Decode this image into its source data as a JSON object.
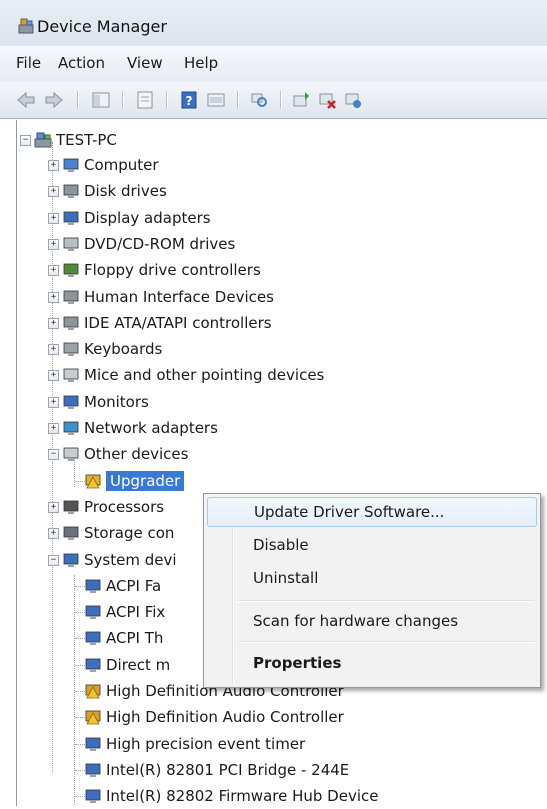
{
  "window": {
    "title": "Device Manager"
  },
  "menu_bar": [
    "File",
    "Action",
    "View",
    "Help"
  ],
  "toolbar": {
    "buttons": [
      "back-arrow-icon",
      "forward-arrow-icon",
      "show-hide-tree-icon",
      "properties-icon",
      "help-icon",
      "update-driver-icon",
      "scan-hardware-icon",
      "update-driver-software-icon",
      "uninstall-icon",
      "disable-icon"
    ]
  },
  "tree": {
    "root": "TEST-PC",
    "items": [
      {
        "label": "Computer",
        "icon": "computer-icon"
      },
      {
        "label": "Disk drives",
        "icon": "disk-drive-icon"
      },
      {
        "label": "Display adapters",
        "icon": "display-adapter-icon"
      },
      {
        "label": "DVD/CD-ROM drives",
        "icon": "dvd-icon"
      },
      {
        "label": "Floppy drive controllers",
        "icon": "floppy-controller-icon"
      },
      {
        "label": "Human Interface Devices",
        "icon": "hid-icon"
      },
      {
        "label": "IDE ATA/ATAPI controllers",
        "icon": "ide-controller-icon"
      },
      {
        "label": "Keyboards",
        "icon": "keyboard-icon"
      },
      {
        "label": "Mice and other pointing devices",
        "icon": "mouse-icon"
      },
      {
        "label": "Monitors",
        "icon": "monitor-icon"
      },
      {
        "label": "Network adapters",
        "icon": "network-adapter-icon"
      },
      {
        "label": "Other devices",
        "icon": "unknown-device-icon"
      },
      {
        "label": "Upgrader",
        "icon": "warning-device-icon"
      },
      {
        "label": "Processors",
        "icon": "processor-icon"
      },
      {
        "label": "Storage con",
        "icon": "storage-controller-icon"
      },
      {
        "label": "System devi",
        "icon": "system-device-icon"
      },
      {
        "label": "ACPI Fa",
        "icon": "system-device-icon"
      },
      {
        "label": "ACPI Fix",
        "icon": "system-device-icon"
      },
      {
        "label": "ACPI Th",
        "icon": "system-device-icon"
      },
      {
        "label": "Direct m",
        "icon": "system-device-icon"
      },
      {
        "label": "High Definition Audio Controller",
        "icon": "audio-controller-icon"
      },
      {
        "label": "High Definition Audio Controller",
        "icon": "audio-controller-icon"
      },
      {
        "label": "High precision event timer",
        "icon": "system-device-icon"
      },
      {
        "label": "Intel(R) 82801 PCI Bridge - 244E",
        "icon": "system-device-icon"
      },
      {
        "label": "Intel(R) 82802 Firmware Hub Device",
        "icon": "system-device-icon"
      }
    ]
  },
  "context_menu": {
    "items": [
      {
        "label": "Update Driver Software..."
      },
      {
        "label": "Disable"
      },
      {
        "label": "Uninstall"
      },
      {
        "label": "Scan for hardware changes"
      },
      {
        "label": "Properties"
      }
    ]
  },
  "colors": {
    "selection": "#3a78d6",
    "menu_hover_border": "#a8c8ec"
  }
}
